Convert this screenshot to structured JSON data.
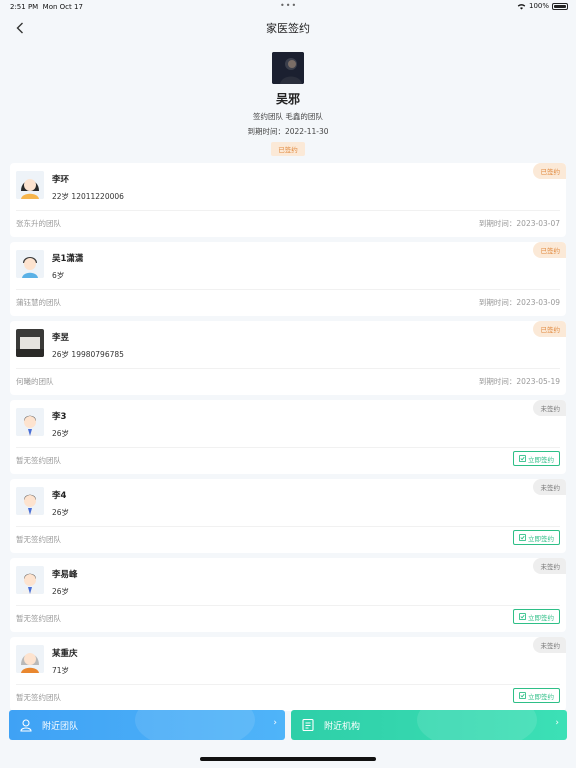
{
  "status": {
    "time": "2:51 PM",
    "date": "Mon Oct 17",
    "battery": "100%"
  },
  "nav": {
    "title": "家医签约"
  },
  "profile": {
    "name": "吴邪",
    "team_line": "签约团队 毛鑫的团队",
    "expire_line": "到期时间：2022-11-30",
    "badge": "已签约"
  },
  "members": [
    {
      "name": "李环",
      "info": "22岁 12011220006",
      "team": "张东升的团队",
      "expire": "到期时间：2023-03-07",
      "tag": "已签约",
      "signed": true
    },
    {
      "name": "吴1潇潇",
      "info": "6岁",
      "team": "蒲钰慧的团队",
      "expire": "到期时间：2023-03-09",
      "tag": "已签约",
      "signed": true
    },
    {
      "name": "李昱",
      "info": "26岁 19980796785",
      "team": "何曦的团队",
      "expire": "到期时间：2023-05-19",
      "tag": "已签约",
      "signed": true
    },
    {
      "name": "李3",
      "info": "26岁",
      "team": "暂无签约团队",
      "tag": "未签约",
      "signed": false,
      "action": "立即签约"
    },
    {
      "name": "李4",
      "info": "26岁",
      "team": "暂无签约团队",
      "tag": "未签约",
      "signed": false,
      "action": "立即签约"
    },
    {
      "name": "李易峰",
      "info": "26岁",
      "team": "暂无签约团队",
      "tag": "未签约",
      "signed": false,
      "action": "立即签约"
    },
    {
      "name": "某重庆",
      "info": "71岁",
      "team": "暂无签约团队",
      "tag": "未签约",
      "signed": false,
      "action": "立即签约"
    }
  ],
  "bottom": {
    "team_label": "附近团队",
    "inst_label": "附近机构"
  },
  "colors": {
    "signed_tag": "#e0883c",
    "action_green": "#2ebf87",
    "team_blue": "#3fa2f5",
    "inst_green": "#2ecfa8"
  },
  "icons": {
    "back": "chevron-left-icon",
    "person": "person-icon",
    "document": "document-icon",
    "sign": "check-square-icon"
  }
}
